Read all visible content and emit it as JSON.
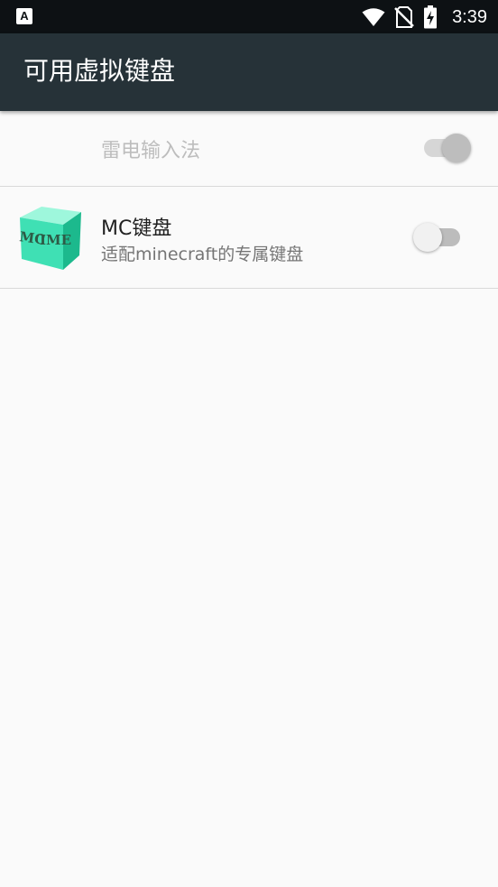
{
  "status_bar": {
    "notification_icon": "a-box-icon",
    "letter": "A",
    "time": "3:39",
    "icons": [
      "wifi-icon",
      "no-sim-icon",
      "battery-charging-icon"
    ]
  },
  "app_bar": {
    "title": "可用虚拟键盘"
  },
  "keyboards": [
    {
      "title": "雷电输入法",
      "enabled": true,
      "toggle_disabled": true
    },
    {
      "title": "MC键盘",
      "summary": "适配minecraft的专属键盘",
      "enabled": false,
      "icon_text": "MC IME"
    }
  ],
  "colors": {
    "app_bar": "#263238",
    "status_bar": "#0d1114",
    "background": "#fafafa",
    "icon_cube": "#3fe0b4"
  }
}
